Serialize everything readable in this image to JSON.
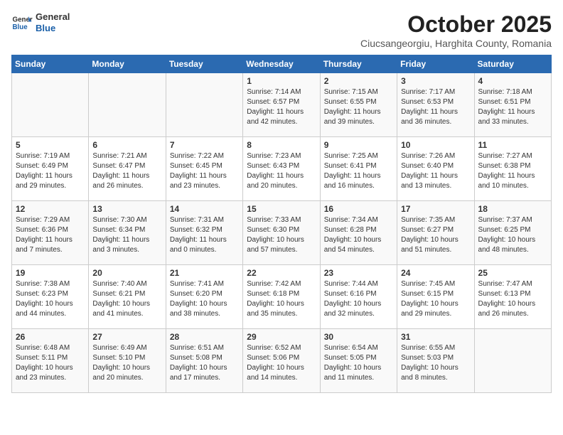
{
  "header": {
    "logo_general": "General",
    "logo_blue": "Blue",
    "month_title": "October 2025",
    "location": "Ciucsangeorgiu, Harghita County, Romania"
  },
  "weekdays": [
    "Sunday",
    "Monday",
    "Tuesday",
    "Wednesday",
    "Thursday",
    "Friday",
    "Saturday"
  ],
  "weeks": [
    [
      {
        "day": "",
        "info": ""
      },
      {
        "day": "",
        "info": ""
      },
      {
        "day": "",
        "info": ""
      },
      {
        "day": "1",
        "info": "Sunrise: 7:14 AM\nSunset: 6:57 PM\nDaylight: 11 hours and 42 minutes."
      },
      {
        "day": "2",
        "info": "Sunrise: 7:15 AM\nSunset: 6:55 PM\nDaylight: 11 hours and 39 minutes."
      },
      {
        "day": "3",
        "info": "Sunrise: 7:17 AM\nSunset: 6:53 PM\nDaylight: 11 hours and 36 minutes."
      },
      {
        "day": "4",
        "info": "Sunrise: 7:18 AM\nSunset: 6:51 PM\nDaylight: 11 hours and 33 minutes."
      }
    ],
    [
      {
        "day": "5",
        "info": "Sunrise: 7:19 AM\nSunset: 6:49 PM\nDaylight: 11 hours and 29 minutes."
      },
      {
        "day": "6",
        "info": "Sunrise: 7:21 AM\nSunset: 6:47 PM\nDaylight: 11 hours and 26 minutes."
      },
      {
        "day": "7",
        "info": "Sunrise: 7:22 AM\nSunset: 6:45 PM\nDaylight: 11 hours and 23 minutes."
      },
      {
        "day": "8",
        "info": "Sunrise: 7:23 AM\nSunset: 6:43 PM\nDaylight: 11 hours and 20 minutes."
      },
      {
        "day": "9",
        "info": "Sunrise: 7:25 AM\nSunset: 6:41 PM\nDaylight: 11 hours and 16 minutes."
      },
      {
        "day": "10",
        "info": "Sunrise: 7:26 AM\nSunset: 6:40 PM\nDaylight: 11 hours and 13 minutes."
      },
      {
        "day": "11",
        "info": "Sunrise: 7:27 AM\nSunset: 6:38 PM\nDaylight: 11 hours and 10 minutes."
      }
    ],
    [
      {
        "day": "12",
        "info": "Sunrise: 7:29 AM\nSunset: 6:36 PM\nDaylight: 11 hours and 7 minutes."
      },
      {
        "day": "13",
        "info": "Sunrise: 7:30 AM\nSunset: 6:34 PM\nDaylight: 11 hours and 3 minutes."
      },
      {
        "day": "14",
        "info": "Sunrise: 7:31 AM\nSunset: 6:32 PM\nDaylight: 11 hours and 0 minutes."
      },
      {
        "day": "15",
        "info": "Sunrise: 7:33 AM\nSunset: 6:30 PM\nDaylight: 10 hours and 57 minutes."
      },
      {
        "day": "16",
        "info": "Sunrise: 7:34 AM\nSunset: 6:28 PM\nDaylight: 10 hours and 54 minutes."
      },
      {
        "day": "17",
        "info": "Sunrise: 7:35 AM\nSunset: 6:27 PM\nDaylight: 10 hours and 51 minutes."
      },
      {
        "day": "18",
        "info": "Sunrise: 7:37 AM\nSunset: 6:25 PM\nDaylight: 10 hours and 48 minutes."
      }
    ],
    [
      {
        "day": "19",
        "info": "Sunrise: 7:38 AM\nSunset: 6:23 PM\nDaylight: 10 hours and 44 minutes."
      },
      {
        "day": "20",
        "info": "Sunrise: 7:40 AM\nSunset: 6:21 PM\nDaylight: 10 hours and 41 minutes."
      },
      {
        "day": "21",
        "info": "Sunrise: 7:41 AM\nSunset: 6:20 PM\nDaylight: 10 hours and 38 minutes."
      },
      {
        "day": "22",
        "info": "Sunrise: 7:42 AM\nSunset: 6:18 PM\nDaylight: 10 hours and 35 minutes."
      },
      {
        "day": "23",
        "info": "Sunrise: 7:44 AM\nSunset: 6:16 PM\nDaylight: 10 hours and 32 minutes."
      },
      {
        "day": "24",
        "info": "Sunrise: 7:45 AM\nSunset: 6:15 PM\nDaylight: 10 hours and 29 minutes."
      },
      {
        "day": "25",
        "info": "Sunrise: 7:47 AM\nSunset: 6:13 PM\nDaylight: 10 hours and 26 minutes."
      }
    ],
    [
      {
        "day": "26",
        "info": "Sunrise: 6:48 AM\nSunset: 5:11 PM\nDaylight: 10 hours and 23 minutes."
      },
      {
        "day": "27",
        "info": "Sunrise: 6:49 AM\nSunset: 5:10 PM\nDaylight: 10 hours and 20 minutes."
      },
      {
        "day": "28",
        "info": "Sunrise: 6:51 AM\nSunset: 5:08 PM\nDaylight: 10 hours and 17 minutes."
      },
      {
        "day": "29",
        "info": "Sunrise: 6:52 AM\nSunset: 5:06 PM\nDaylight: 10 hours and 14 minutes."
      },
      {
        "day": "30",
        "info": "Sunrise: 6:54 AM\nSunset: 5:05 PM\nDaylight: 10 hours and 11 minutes."
      },
      {
        "day": "31",
        "info": "Sunrise: 6:55 AM\nSunset: 5:03 PM\nDaylight: 10 hours and 8 minutes."
      },
      {
        "day": "",
        "info": ""
      }
    ]
  ]
}
